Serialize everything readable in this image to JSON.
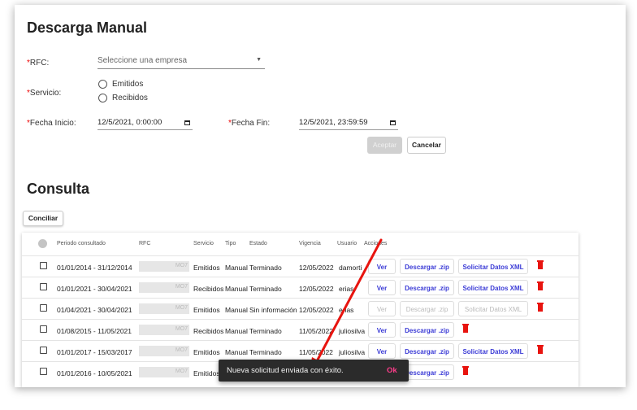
{
  "download": {
    "title": "Descarga Manual",
    "rfc_label": "RFC:",
    "rfc_placeholder": "Seleccione una empresa",
    "servicio_label": "Servicio:",
    "options": [
      "Emitidos",
      "Recibidos"
    ],
    "fecha_inicio_label": "Fecha Inicio:",
    "fecha_inicio_value": "12/5/2021, 0:00:00",
    "fecha_fin_label": "Fecha Fin:",
    "fecha_fin_value": "12/5/2021, 23:59:59",
    "required_mark": "*",
    "accept_label": "Aceptar",
    "cancel_label": "Cancelar"
  },
  "consulta": {
    "title": "Consulta",
    "conciliar_label": "Conciliar",
    "columns": [
      "Periodo consultado",
      "RFC",
      "Servicio",
      "Tipo",
      "Estado",
      "Vigencia",
      "Usuario",
      "Acciones"
    ],
    "rows": [
      {
        "periodo": "01/01/2014 - 31/12/2014",
        "rfc": "MO7",
        "servicio": "Emitidos",
        "tipo": "Manual",
        "estado": "Terminado",
        "vigencia": "12/05/2022",
        "usuario": "damorti",
        "ver": "Ver",
        "zip": "Descargar .zip",
        "xml": "Solicitar Datos XML",
        "disabled": false
      },
      {
        "periodo": "01/01/2021 - 30/04/2021",
        "rfc": "MO7",
        "servicio": "Recibidos",
        "tipo": "Manual",
        "estado": "Terminado",
        "vigencia": "12/05/2022",
        "usuario": "erias",
        "ver": "Ver",
        "zip": "Descargar .zip",
        "xml": "Solicitar Datos XML",
        "disabled": false
      },
      {
        "periodo": "01/04/2021 - 30/04/2021",
        "rfc": "MO7",
        "servicio": "Emitidos",
        "tipo": "Manual",
        "estado": "Sin información",
        "vigencia": "12/05/2022",
        "usuario": "erias",
        "ver": "Ver",
        "zip": "Descargar .zip",
        "xml": "Solicitar Datos XML",
        "disabled": true
      },
      {
        "periodo": "01/08/2015 - 11/05/2021",
        "rfc": "MO7",
        "servicio": "Recibidos",
        "tipo": "Manual",
        "estado": "Terminado",
        "vigencia": "11/05/2022",
        "usuario": "juliosilva",
        "ver": "Ver",
        "zip": "Descargar .zip",
        "xml": "",
        "disabled": false
      },
      {
        "periodo": "01/01/2017 - 15/03/2017",
        "rfc": "MO7",
        "servicio": "Emitidos",
        "tipo": "Manual",
        "estado": "Terminado",
        "vigencia": "11/05/2022",
        "usuario": "juliosilva",
        "ver": "Ver",
        "zip": "Descargar .zip",
        "xml": "Solicitar Datos XML",
        "disabled": false
      },
      {
        "periodo": "01/01/2016 - 10/05/2021",
        "rfc": "MO7",
        "servicio": "Emitidos",
        "tipo": "",
        "estado": "",
        "vigencia": "",
        "usuario": "",
        "ver": "",
        "zip": "Descargar .zip",
        "xml": "",
        "disabled": false
      }
    ]
  },
  "snackbar": {
    "message": "Nueva solicitud enviada con éxito.",
    "action": "Ok"
  },
  "colors": {
    "link": "#3b3bd6",
    "delete": "#e8140f",
    "snackbar_action": "#ff3d8b",
    "arrow": "#e8140f"
  }
}
